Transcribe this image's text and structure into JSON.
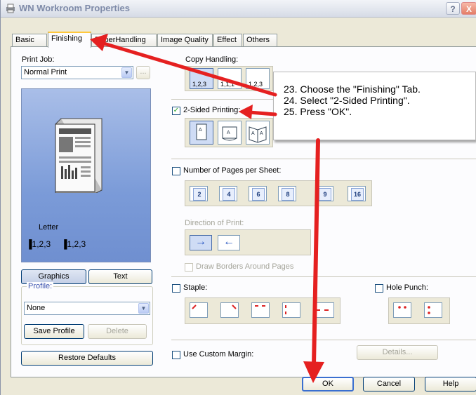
{
  "window": {
    "title": "WN Workroom Properties",
    "help_btn": "?",
    "close_btn": "X"
  },
  "tabs": [
    "Basic",
    "Finishing",
    "PaperHandling",
    "Image Quality",
    "Effect",
    "Others"
  ],
  "print_job": {
    "label": "Print Job:",
    "value": "Normal Print",
    "more": "..."
  },
  "preview": {
    "paper": "Letter",
    "copy_a": "1,2,3",
    "copy_b": "1,2,3"
  },
  "left_buttons": {
    "graphics": "Graphics",
    "text": "Text"
  },
  "profile": {
    "label": "Profile:",
    "value": "None",
    "save": "Save Profile",
    "delete": "Delete"
  },
  "restore_defaults": "Restore Defaults",
  "copy_handling": {
    "label": "Copy Handling:",
    "options": [
      "1,2,3",
      "1,1,1",
      "1,2,3"
    ]
  },
  "two_sided": {
    "label": "2-Sided Printing:",
    "checked": "✓"
  },
  "pages_per_sheet": {
    "label": "Number of Pages per Sheet:",
    "options": [
      "2",
      "4",
      "6",
      "8",
      "9",
      "16"
    ]
  },
  "direction": {
    "label": "Direction of Print:",
    "arrow_right": "→",
    "arrow_left": "←"
  },
  "borders": {
    "label": "Draw Borders Around Pages"
  },
  "staple": {
    "label": "Staple:"
  },
  "hole_punch": {
    "label": "Hole Punch:"
  },
  "custom_margin": {
    "label": "Use Custom Margin:",
    "details": "Details..."
  },
  "footer": {
    "ok": "OK",
    "cancel": "Cancel",
    "help": "Help"
  },
  "callout": {
    "steps": [
      "Choose the \"Finishing\" Tab.",
      "Select \"2-Sided Printing\".",
      "Press \"OK\"."
    ],
    "numbers": [
      "23.",
      "24.",
      "25."
    ]
  },
  "colors": {
    "arrow": "#e52020",
    "preview_bg": "#7b9bd8",
    "tab_highlight": "#ffc83c"
  }
}
